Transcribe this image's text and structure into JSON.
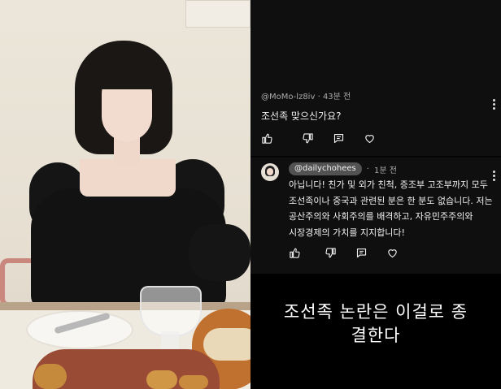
{
  "comment1": {
    "username": "@MoMo-lz8iv",
    "separator": "·",
    "time": "43분 전",
    "text": "조선족 맞으신가요?"
  },
  "comment2": {
    "username": "@dailychohees",
    "separator": "·",
    "time": "1분 전",
    "text": "아닙니다! 친가 및 외가 친척, 증조부 고조부까지 모두 조선족이나 중국과 관련된 분은 한 분도 없습니다. 저는 공산주의와 사회주의를 배격하고, 자유민주주의와 시장경제의 가치를 지지합니다!"
  },
  "caption": {
    "line1": "조선족 논란은 이걸로 종",
    "line2": "결한다"
  },
  "icons": [
    "like-icon",
    "dislike-icon",
    "reply-icon",
    "heart-icon",
    "more-vertical-icon"
  ],
  "colors": {
    "panel_bg": "#0f0f0f",
    "meta_text": "#aaaaaa",
    "pill_bg": "#525252"
  }
}
